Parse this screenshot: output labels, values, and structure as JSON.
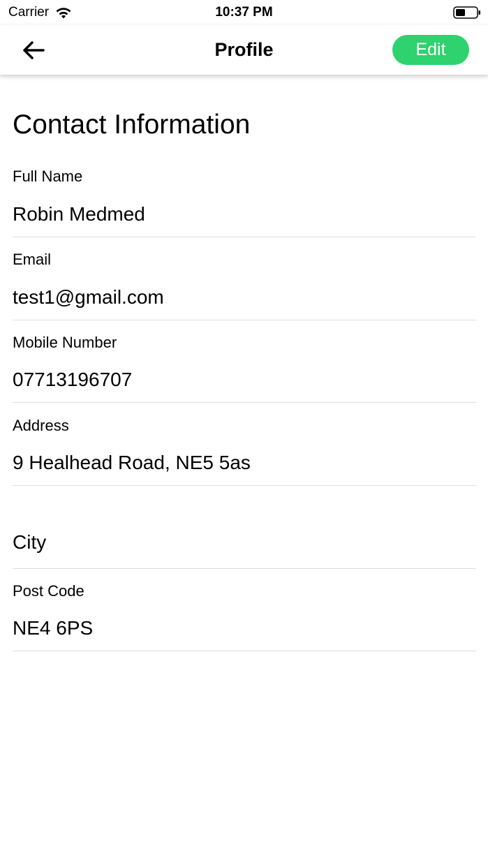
{
  "status_bar": {
    "carrier": "Carrier",
    "time": "10:37 PM"
  },
  "nav": {
    "title": "Profile",
    "edit_label": "Edit"
  },
  "colors": {
    "accent": "#2ed26e",
    "divider": "#dedede"
  },
  "section_title": "Contact Information",
  "fields": [
    {
      "label": "Full Name",
      "value": "Robin Medmed"
    },
    {
      "label": "Email",
      "value": "test1@gmail.com"
    },
    {
      "label": "Mobile Number",
      "value": "07713196707"
    },
    {
      "label": "Address",
      "value": "9 Healhead Road, NE5 5as"
    },
    {
      "label": "",
      "value": "City"
    },
    {
      "label": "Post Code",
      "value": "NE4 6PS"
    }
  ]
}
